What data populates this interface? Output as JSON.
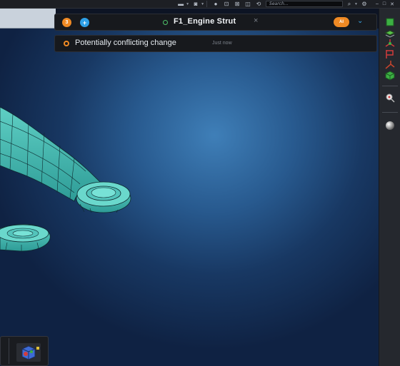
{
  "toolbar": {
    "search_placeholder": "Search...",
    "icons": [
      "display-mode-icon",
      "camera-icon",
      "light-icon",
      "view-fit-icon",
      "view-box-icon",
      "view-section-icon",
      "view-transform-icon",
      "search-icon",
      "settings-icon",
      "minimize-icon",
      "restore-icon",
      "close-icon"
    ]
  },
  "collab_panel": {
    "member_count": "3",
    "add_label": "+",
    "document_title": "F1_Engine Strut",
    "close_glyph": "×",
    "user_initials": "AI",
    "expand_glyph": "⌄"
  },
  "notification": {
    "message": "Potentially conflicting change",
    "time": "Just now"
  },
  "colors": {
    "accent_orange": "#f08a24",
    "accent_blue": "#2ea0e6",
    "status_green": "#4fc36a",
    "part_teal": "#3fb5ad"
  },
  "right_toolbar": {
    "icons": [
      "green-cube-top-icon",
      "layers-icon",
      "axis-red-icon",
      "flag-red-icon",
      "axis-transform-icon",
      "green-cube-icon",
      "magnifier-icon",
      "material-sphere-icon"
    ]
  }
}
